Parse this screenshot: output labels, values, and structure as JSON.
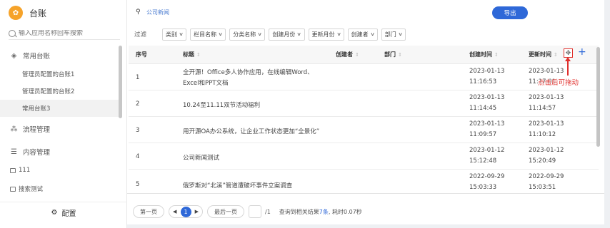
{
  "sidebar": {
    "brand_logo_char": "✿",
    "title": "台账",
    "search_placeholder": "输入应用名称回车搜索",
    "common_group": "常用台账",
    "common_items": [
      {
        "label": "管理员配置的台账1"
      },
      {
        "label": "管理员配置的台账2"
      },
      {
        "label": "常用台账3"
      }
    ],
    "flow_group": "流程管理",
    "content_group": "内容管理",
    "leaf_items": [
      {
        "label": "111"
      },
      {
        "label": "搜索测试"
      }
    ],
    "config_label": "配置"
  },
  "breadcrumb": "公司新闻",
  "export_label": "导出",
  "filter_label": "过滤",
  "filters": [
    {
      "label": "类别"
    },
    {
      "label": "栏目名称"
    },
    {
      "label": "分类名称"
    },
    {
      "label": "创建月份"
    },
    {
      "label": "更新月份"
    },
    {
      "label": "创建者"
    },
    {
      "label": "部门"
    }
  ],
  "columns": {
    "index": "序号",
    "title": "标题",
    "creator": "创建者",
    "dept": "部门",
    "created": "创建时间",
    "updated": "更新时间"
  },
  "rows": [
    {
      "index": "1",
      "title1": "全开源！Office多人协作应用，在线编辑Word、",
      "title2": "Excel和PPT文档",
      "c_date": "2023-01-13",
      "c_time": "11:16:53",
      "u_date": "2023-01-13",
      "u_time": "11:17:01"
    },
    {
      "index": "2",
      "title1": "10.24至11.11双节活动福利",
      "title2": "",
      "c_date": "2023-01-13",
      "c_time": "11:14:45",
      "u_date": "2023-01-13",
      "u_time": "11:14:57"
    },
    {
      "index": "3",
      "title1": "用开源OA办公系统，让企业工作状态更加“全景化”",
      "title2": "",
      "c_date": "2023-01-13",
      "c_time": "11:09:57",
      "u_date": "2023-01-13",
      "u_time": "11:10:12"
    },
    {
      "index": "4",
      "title1": "公司新闻测试",
      "title2": "",
      "c_date": "2023-01-12",
      "c_time": "15:12:48",
      "u_date": "2023-01-12",
      "u_time": "15:20:49"
    },
    {
      "index": "5",
      "title1": "俄罗斯对“北溪”管道遭破坏事件立案调查",
      "title2": "",
      "c_date": "2022-09-29",
      "c_time": "15:03:33",
      "u_date": "2022-09-29",
      "u_time": "15:03:51"
    }
  ],
  "drag_note": "点击后可拖动",
  "add_column_symbol": "+",
  "pager": {
    "first": "第一页",
    "current": "1",
    "last": "最后一页",
    "total": "/1",
    "info_prefix": "查询到相关结果",
    "info_count": "7条",
    "info_suffix": ", 耗时0.07秒"
  },
  "colors": {
    "accent": "#2e68d8",
    "annotation": "#e0302d",
    "brand": "#f6a32a"
  }
}
